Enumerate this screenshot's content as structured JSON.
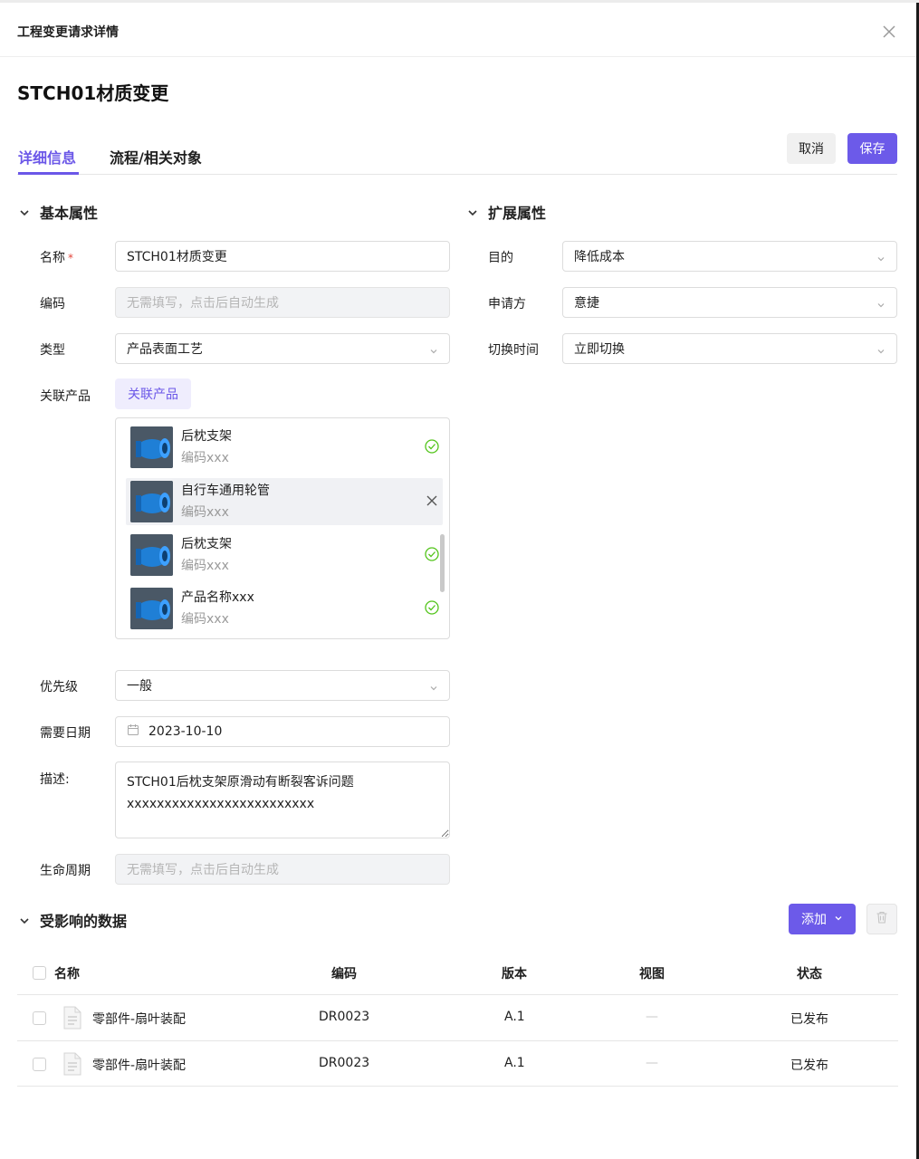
{
  "header": {
    "title": "工程变更请求详情"
  },
  "page": {
    "title": "STCH01材质变更"
  },
  "tabs": [
    {
      "label": "详细信息",
      "active": true
    },
    {
      "label": "流程/相关对象",
      "active": false
    }
  ],
  "actions": {
    "cancel": "取消",
    "save": "保存"
  },
  "basic": {
    "title": "基本属性",
    "name_label": "名称",
    "name_required": "*",
    "name_value": "STCH01材质变更",
    "code_label": "编码",
    "code_placeholder": "无需填写，点击后自动生成",
    "type_label": "类型",
    "type_value": "产品表面工艺",
    "related_label": "关联产品",
    "related_button": "关联产品",
    "products": [
      {
        "name": "后枕支架",
        "code": "编码xxx",
        "status": "check-circle-icon",
        "highlighted": false
      },
      {
        "name": "自行车通用轮管",
        "code": "编码xxx",
        "status": "close-icon",
        "highlighted": true
      },
      {
        "name": "后枕支架",
        "code": "编码xxx",
        "status": "check-circle-icon",
        "highlighted": false
      },
      {
        "name": "产品名称xxx",
        "code": "编码xxx",
        "status": "check-circle-icon",
        "highlighted": false
      }
    ],
    "priority_label": "优先级",
    "priority_value": "一般",
    "date_label": "需要日期",
    "date_value": "2023-10-10",
    "desc_label": "描述:",
    "desc_value": "STCH01后枕支架原滑动有断裂客诉问题\nxxxxxxxxxxxxxxxxxxxxxxxxx",
    "lifecycle_label": "生命周期",
    "lifecycle_placeholder": "无需填写，点击后自动生成"
  },
  "extended": {
    "title": "扩展属性",
    "purpose_label": "目的",
    "purpose_value": "降低成本",
    "applicant_label": "申请方",
    "applicant_value": "意捷",
    "switch_label": "切换时间",
    "switch_value": "立即切换"
  },
  "affected": {
    "title": "受影响的数据",
    "add_label": "添加",
    "columns": {
      "name": "名称",
      "code": "编码",
      "version": "版本",
      "view": "视图",
      "status": "状态"
    },
    "rows": [
      {
        "name": "零部件-扇叶装配",
        "code": "DR0023",
        "version": "A.1",
        "view": "—",
        "status": "已发布"
      },
      {
        "name": "零部件-扇叶装配",
        "code": "DR0023",
        "version": "A.1",
        "view": "—",
        "status": "已发布"
      }
    ]
  },
  "colors": {
    "accent": "#6c5ae9",
    "success": "#52c41a"
  }
}
